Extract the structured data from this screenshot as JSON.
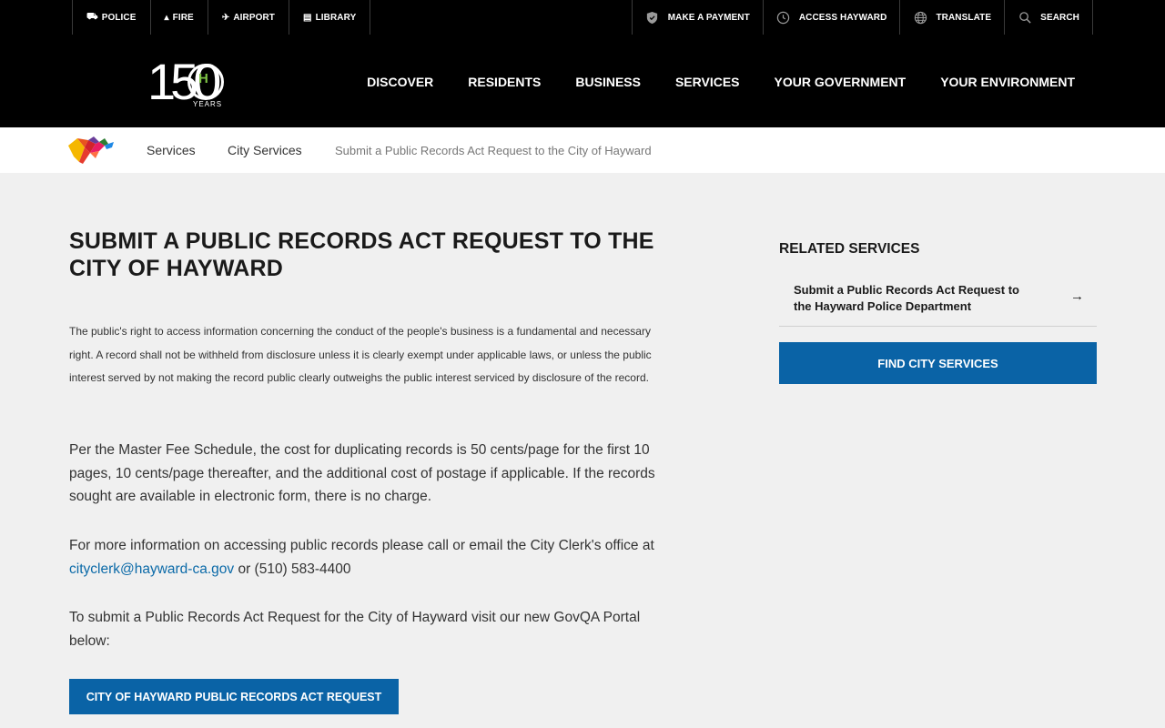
{
  "utility_left": [
    {
      "icon": "police-car-icon",
      "glyph": "⛟",
      "label": "POLICE"
    },
    {
      "icon": "fire-icon",
      "glyph": "▴",
      "label": "FIRE"
    },
    {
      "icon": "airplane-icon",
      "glyph": "✈",
      "label": "AIRPORT"
    },
    {
      "icon": "book-icon",
      "glyph": "▤",
      "label": "LIBRARY"
    }
  ],
  "utility_right": [
    {
      "icon": "shield-icon",
      "label": "MAKE A PAYMENT"
    },
    {
      "icon": "clock-icon",
      "label": "ACCESS HAYWARD"
    },
    {
      "icon": "globe-icon",
      "label": "TRANSLATE"
    },
    {
      "icon": "search-icon",
      "label": "SEARCH"
    }
  ],
  "logo": {
    "number": "150",
    "letter": "H",
    "years": "YEARS",
    "accent": "#7ec246"
  },
  "nav": [
    "DISCOVER",
    "RESIDENTS",
    "BUSINESS",
    "SERVICES",
    "YOUR GOVERNMENT",
    "YOUR ENVIRONMENT"
  ],
  "breadcrumb": {
    "items": [
      "Services",
      "City Services"
    ],
    "current": "Submit a Public Records Act Request to the City of Hayward"
  },
  "main": {
    "title": "SUBMIT A PUBLIC RECORDS ACT REQUEST TO THE CITY OF HAYWARD",
    "intro": "The public's right to access information concerning the conduct of the people's business is a fundamental and necessary right. A record shall not be withheld from disclosure unless it is clearly exempt under applicable laws, or unless the public interest served by not making the record public clearly outweighs the public interest serviced by disclosure of the record.",
    "fee": "Per the Master Fee Schedule, the cost for duplicating records is 50 cents/page for the first 10 pages, 10 cents/page thereafter, and the additional cost of postage if applicable. If the records sought are available in electronic form, there is no charge.",
    "contact_prefix": "For more information on accessing public records please call or email the City Clerk's office at ",
    "contact_email": "cityclerk@hayward-ca.gov",
    "contact_suffix": " or (510) 583-4400",
    "portal": "To submit a Public Records Act Request for the City of Hayward visit our new GovQA Portal below:",
    "button": "CITY OF HAYWARD PUBLIC RECORDS ACT REQUEST"
  },
  "sidebar": {
    "title": "RELATED SERVICES",
    "related": "Submit a Public Records Act Request to the Hayward Police Department",
    "arrow": "→",
    "find_button": "FIND CITY SERVICES"
  },
  "colors": {
    "brand_blue": "#0a63a6",
    "link": "#0b6aa8"
  }
}
